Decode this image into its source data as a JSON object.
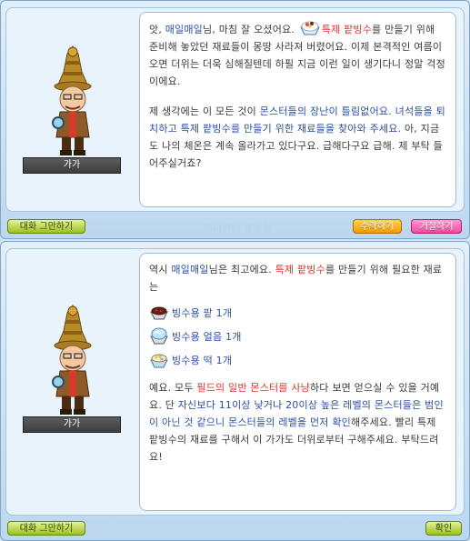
{
  "dialog1": {
    "npc_name": "가가",
    "para1_part1": "앗, ",
    "player_name": "매일매일",
    "para1_part2": "님, 마침 잘 오셨어요. ",
    "quest_item": "특제 팥빙수",
    "para1_part3": "를 만들기 위해 준비해 놓았던 재료들이 몽땅 사라져 버렸어요. 이제 본격적인 여름이 오면 더위는 더욱 심해질텐데 하필 지금 이런 일이 생기다니 정말 걱정이에요.",
    "para2_part1": "제 생각에는 이 모든 것이 ",
    "para2_hl1": "몬스터들의 장난이 틀림없어요. 녀석들을 퇴치하고 특제 팥빙수를 만들기 위한 재료들을 찾아와 주세요.",
    "para2_part2": " 아, 지금도 나의 체온은 계속 올라가고 있다구요. 급해다구요 급해. 제 부탁 들어주실거죠?",
    "end_chat": "대화 그만하기",
    "accept": "수락하기",
    "decline": "거절하기",
    "faded_text": "미니멕티 열매필"
  },
  "dialog2": {
    "npc_name": "가가",
    "intro_part1": "역시 ",
    "player_name": "매일매일",
    "intro_part2": "님은 최고에요. ",
    "quest_item": "특제 팥빙수",
    "intro_part3": "를 만들기 위해 필요한 재료는",
    "items": [
      {
        "label": "빙수용 팥 1개",
        "icon": "red-bean-bowl-icon"
      },
      {
        "label": "빙수용 얼음 1개",
        "icon": "ice-bowl-icon"
      },
      {
        "label": "빙수용 떡 1개",
        "icon": "rice-cake-bowl-icon"
      }
    ],
    "para_part1": "예요. 모두 ",
    "para_hl1": "필드의 일반 몬스터를 사냥",
    "para_part2": "하다 보면 얻으실 수 있을 거예요. 단 ",
    "para_hl2": "자신보다 11이상 낮거나 20이상 높은 레벨의 몬스터들은 범인이 아닌 것 같으니 몬스터들의 레벨을 먼저 확인",
    "para_part3": "해주세요. 빨리 특제 팥빙수의 재료를 구해서 이 가가도 더위로부터 구해주세요. 부탁드려요!",
    "end_chat": "대화 그만하기",
    "ok": "확인"
  }
}
